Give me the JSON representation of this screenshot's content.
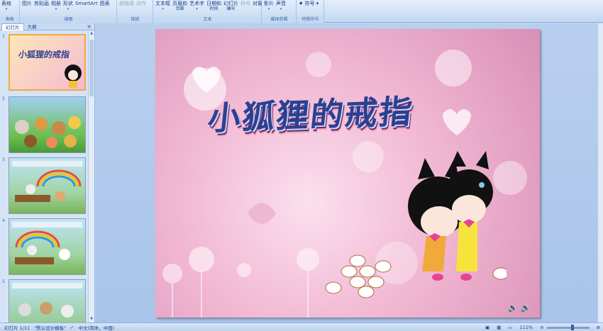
{
  "ribbon": {
    "groups": [
      {
        "name": "表格",
        "items": [
          {
            "label": "表格",
            "sub": ""
          }
        ]
      },
      {
        "name": "插图",
        "items": [
          {
            "label": "图片"
          },
          {
            "label": "剪贴画"
          },
          {
            "label": "相册"
          },
          {
            "label": "形状"
          },
          {
            "label": "SmartArt"
          },
          {
            "label": "图表"
          }
        ]
      },
      {
        "name": "链接",
        "items": [
          {
            "label": "超链接"
          },
          {
            "label": "动作"
          }
        ]
      },
      {
        "name": "文本",
        "items": [
          {
            "label": "文本框"
          },
          {
            "label": "页眉和",
            "sub": "页脚"
          },
          {
            "label": "艺术字"
          },
          {
            "label": "日期和",
            "sub": "时间"
          },
          {
            "label": "幻灯片",
            "sub": "编号"
          },
          {
            "label": "符号"
          },
          {
            "label": "对象"
          }
        ]
      },
      {
        "name": "媒体剪辑",
        "items": [
          {
            "label": "影片"
          },
          {
            "label": "声音"
          }
        ]
      },
      {
        "name": "特殊符号",
        "items": [
          {
            "label": "符号"
          }
        ]
      }
    ]
  },
  "pane": {
    "tabs": [
      "幻灯片",
      "大纲"
    ],
    "close": "×",
    "slides": [
      {
        "num": "1",
        "title": "小狐狸的戒指"
      },
      {
        "num": "2"
      },
      {
        "num": "3"
      },
      {
        "num": "4"
      },
      {
        "num": "5"
      }
    ]
  },
  "slide": {
    "title": "小狐狸的戒指"
  },
  "status": {
    "slide_info": "幻灯片 1/11",
    "theme": "\"默认设计模板\"",
    "language": "中文(简体，中国)",
    "zoom": "111%"
  }
}
